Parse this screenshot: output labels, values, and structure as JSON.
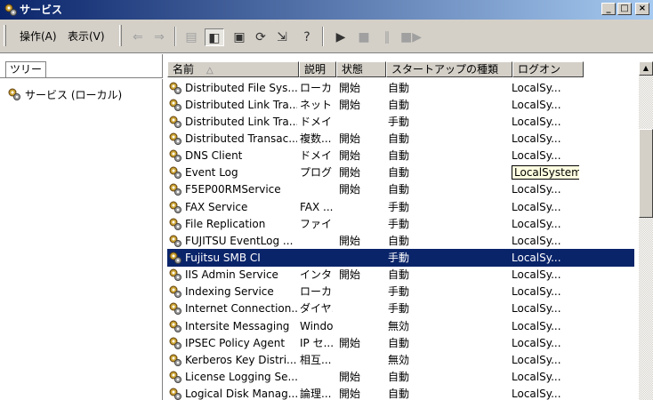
{
  "window": {
    "title": "サービス"
  },
  "menu": {
    "action": "操作(A)",
    "view": "表示(V)"
  },
  "toolbar": {
    "buttons": [
      "back",
      "forward",
      "up-folder",
      "show-hide-tree",
      "properties",
      "refresh",
      "export-list",
      "help",
      "start",
      "stop",
      "pause",
      "restart"
    ]
  },
  "tree": {
    "tab_label": "ツリー",
    "root_label": "サービス (ローカル)"
  },
  "columns": {
    "name": "名前",
    "desc": "説明",
    "state": "状態",
    "startup": "スタートアップの種類",
    "logon": "ログオン"
  },
  "services": [
    {
      "name": "Distributed File Sys...",
      "desc": "ローカ...",
      "state": "開始",
      "startup": "自動",
      "logon": "LocalSy..."
    },
    {
      "name": "Distributed Link Tra...",
      "desc": "ネット...",
      "state": "開始",
      "startup": "自動",
      "logon": "LocalSy..."
    },
    {
      "name": "Distributed Link Tra...",
      "desc": "ドメイ...",
      "state": "",
      "startup": "手動",
      "logon": "LocalSy..."
    },
    {
      "name": "Distributed Transac...",
      "desc": "複数...",
      "state": "開始",
      "startup": "自動",
      "logon": "LocalSy..."
    },
    {
      "name": "DNS Client",
      "desc": "ドメイ...",
      "state": "開始",
      "startup": "自動",
      "logon": "LocalSy..."
    },
    {
      "name": "Event Log",
      "desc": "プログ...",
      "state": "開始",
      "startup": "自動",
      "logon": "LocalSystem"
    },
    {
      "name": "F5EP00RMService",
      "desc": "",
      "state": "開始",
      "startup": "自動",
      "logon": "LocalSy..."
    },
    {
      "name": "FAX Service",
      "desc": "FAX ...",
      "state": "",
      "startup": "手動",
      "logon": "LocalSy..."
    },
    {
      "name": "File Replication",
      "desc": "ファイ...",
      "state": "",
      "startup": "手動",
      "logon": "LocalSy..."
    },
    {
      "name": "FUJITSU EventLog ...",
      "desc": "",
      "state": "開始",
      "startup": "自動",
      "logon": "LocalSy..."
    },
    {
      "name": "Fujitsu SMB CI",
      "desc": "",
      "state": "",
      "startup": "手動",
      "logon": "LocalSy..."
    },
    {
      "name": "IIS Admin Service",
      "desc": "インタ...",
      "state": "開始",
      "startup": "自動",
      "logon": "LocalSy..."
    },
    {
      "name": "Indexing Service",
      "desc": "ローカ...",
      "state": "",
      "startup": "手動",
      "logon": "LocalSy..."
    },
    {
      "name": "Internet Connection...",
      "desc": "ダイヤ...",
      "state": "",
      "startup": "手動",
      "logon": "LocalSy..."
    },
    {
      "name": "Intersite Messaging",
      "desc": "Windo...",
      "state": "",
      "startup": "無効",
      "logon": "LocalSy..."
    },
    {
      "name": "IPSEC Policy Agent",
      "desc": "IP セ...",
      "state": "開始",
      "startup": "自動",
      "logon": "LocalSy..."
    },
    {
      "name": "Kerberos Key Distri...",
      "desc": "相互...",
      "state": "",
      "startup": "無効",
      "logon": "LocalSy..."
    },
    {
      "name": "License Logging Se...",
      "desc": "",
      "state": "開始",
      "startup": "自動",
      "logon": "LocalSy..."
    },
    {
      "name": "Logical Disk Manag...",
      "desc": "論理...",
      "state": "開始",
      "startup": "自動",
      "logon": "LocalSy..."
    }
  ],
  "selected_index": 10,
  "tooltip_index": 5,
  "colors": {
    "selection": "#0a246a",
    "face": "#d4d0c8",
    "tooltip": "#ffffe1"
  }
}
